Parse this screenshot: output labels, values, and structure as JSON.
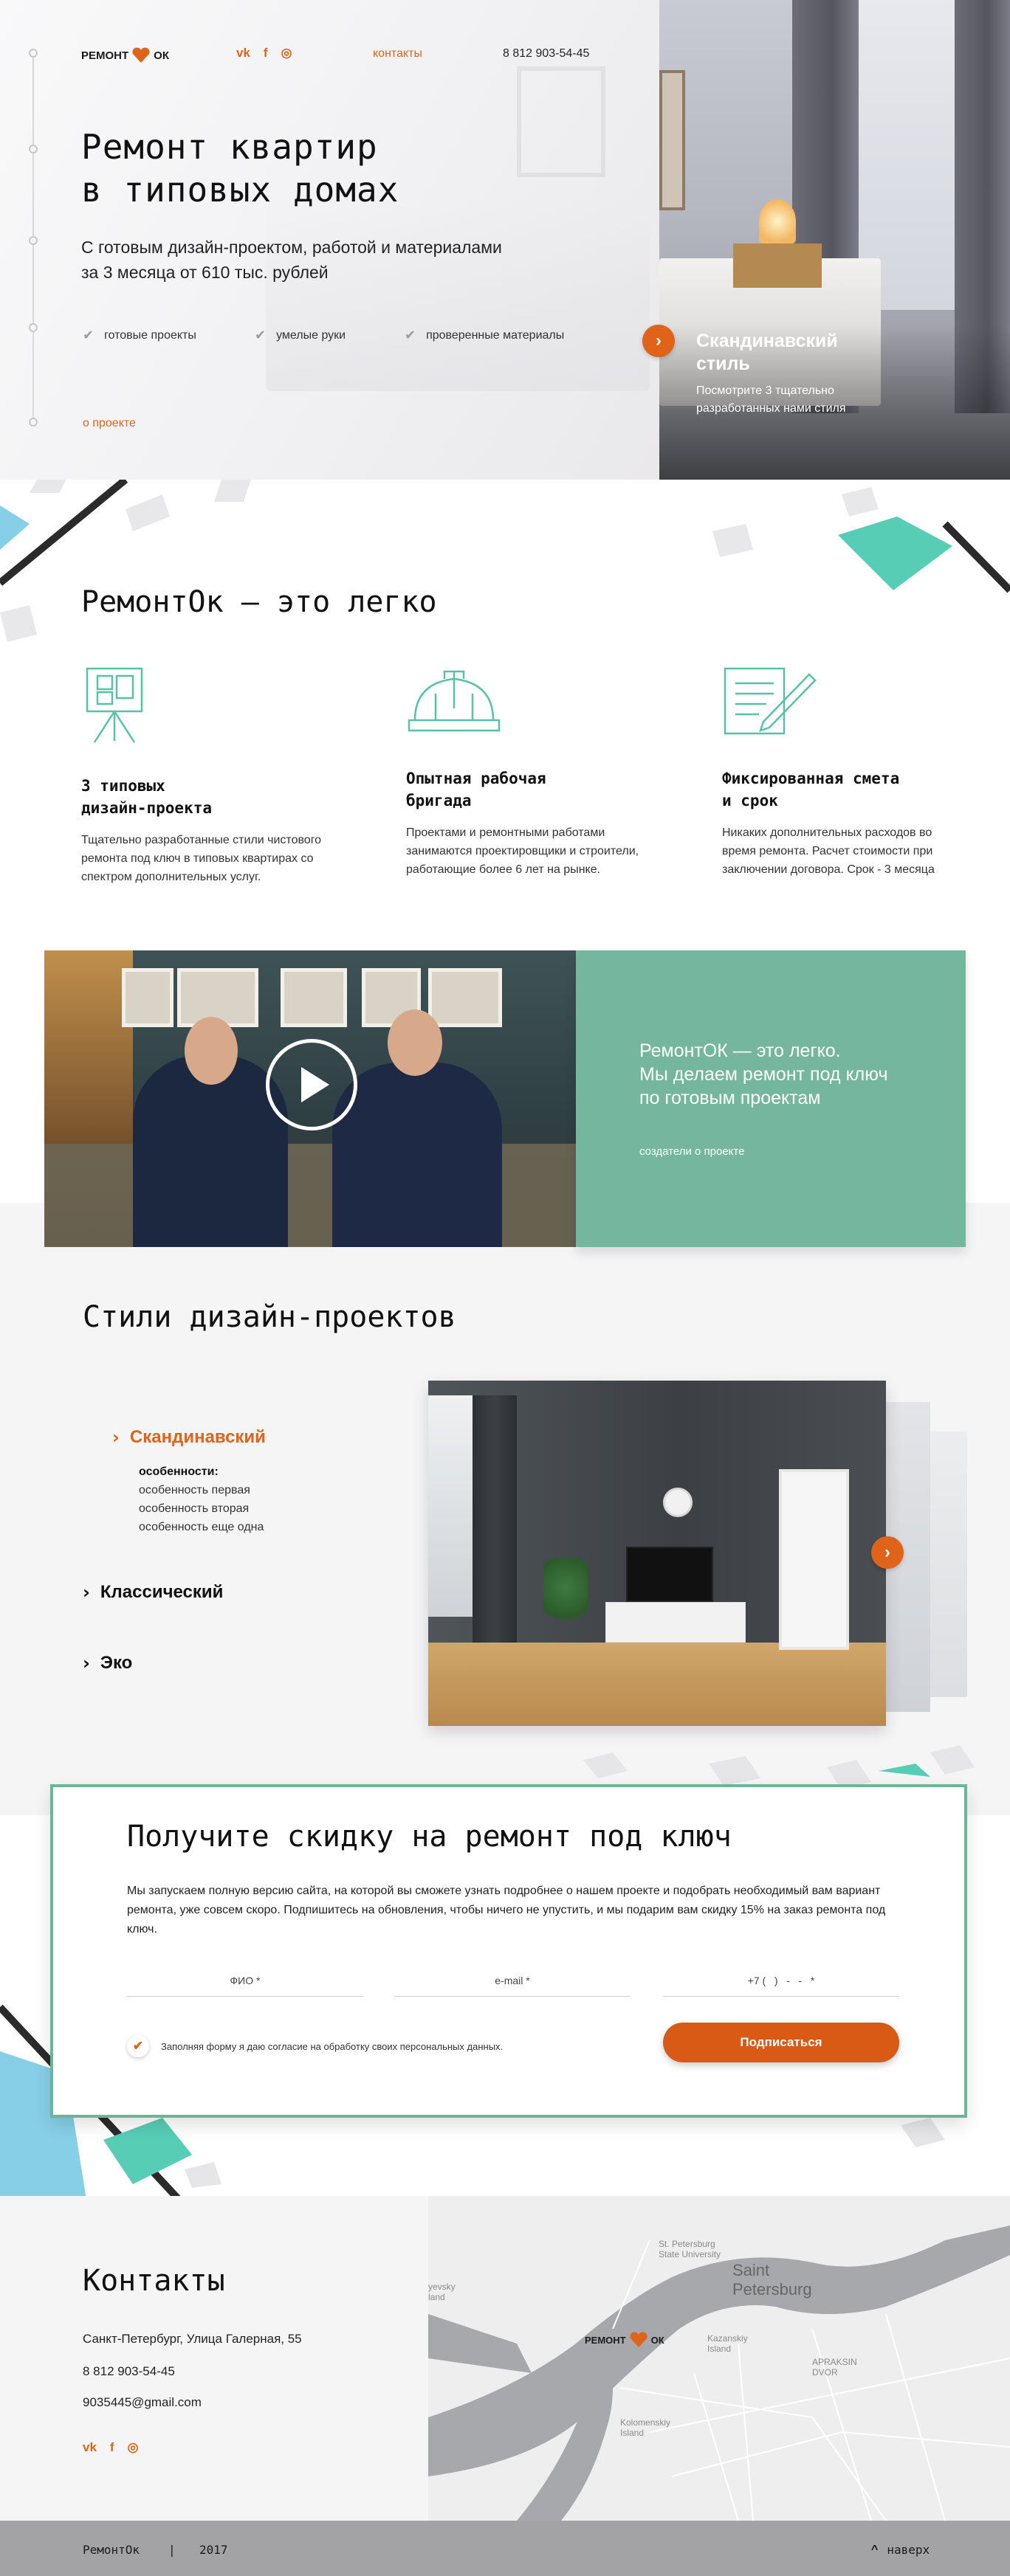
{
  "brand": {
    "logo_left": "РЕМОНТ",
    "logo_right": "ОК",
    "accent": "#e0631a",
    "green": "#75b79e"
  },
  "header": {
    "social": [
      {
        "icon": "vk-icon",
        "glyph": "vk"
      },
      {
        "icon": "facebook-icon",
        "glyph": "f"
      },
      {
        "icon": "instagram-icon",
        "glyph": "◎"
      }
    ],
    "contacts_link": "контакты",
    "phone": "8 812 903-54-45"
  },
  "hero": {
    "title_line1": "Ремонт квартир",
    "title_line2": "в типовых домах",
    "subtitle_line1": "С готовым дизайн-проектом, работой и материалами",
    "subtitle_line2": "за 3 месяца от 610 тыс. рублей",
    "features": [
      "готовые проекты",
      "умелые руки",
      "проверенные материалы"
    ],
    "about_link": "о проекте",
    "style_card_title_line1": "Скандинавский",
    "style_card_title_line2": "стиль",
    "style_card_desc_line1": "Посмотрите 3 тщательно",
    "style_card_desc_line2": "разработанных нами стиля"
  },
  "easy": {
    "title": "РемонтОк — это легко",
    "items": [
      {
        "icon": "easel-icon",
        "title_line1": "3 типовых",
        "title_line2": "дизайн-проекта",
        "desc_line1": "Тщательно разработанные стили чистового",
        "desc_line2": "ремонта под ключ в типовых квартирах со",
        "desc_line3": "спектром дополнительных услуг."
      },
      {
        "icon": "hard-hat-icon",
        "title_line1": "Опытная рабочая",
        "title_line2": "бригада",
        "desc_line1": "Проектами и ремонтными работами",
        "desc_line2": "занимаются проектировщики и строители,",
        "desc_line3": "работающие более 6 лет на рынке."
      },
      {
        "icon": "document-pen-icon",
        "title_line1": "Фиксированная смета",
        "title_line2": "и срок",
        "desc_line1": "Никаких дополнительных расходов во",
        "desc_line2": "время ремонта. Расчет стоимости при",
        "desc_line3": "заключении договора. Срок - 3 месяца"
      }
    ]
  },
  "video": {
    "line1": "РемонтОК — это легко.",
    "line2": "Мы делаем ремонт под ключ",
    "line3": "по готовым проектам",
    "link": "создатели о проекте"
  },
  "styles": {
    "title": "Стили дизайн-проектов",
    "items": [
      "Скандинавский",
      "Классический",
      "Эко"
    ],
    "features_header": "особенности:",
    "features": [
      "особенность первая",
      "особенность вторая",
      "особенность еще одна"
    ]
  },
  "discount": {
    "title": "Получите скидку на ремонт под ключ",
    "text": "Мы запускаем полную версию сайта, на которой вы сможете узнать подробнее о нашем проекте и подобрать необходимый вам вариант ремонта, уже совсем скоро. Подпишитесь на обновления, чтобы ничего не упустить, и мы подарим вам скидку 15% на заказ ремонта под ключ.",
    "name_placeholder": "ФИО *",
    "email_placeholder": "e-mail *",
    "phone_placeholder": "+7 (   )   -   -   *",
    "consent": "Заполняя форму я даю согласие на обработку своих персональных данных.",
    "button": "Подписаться"
  },
  "contacts": {
    "title": "Контакты",
    "address": "Санкт-Петербург, Улица Галерная, 55",
    "phone": "8 812 903-54-45",
    "email": "9035445@gmail.com",
    "map": {
      "city_line1": "Saint",
      "city_line2": "Petersburg",
      "univ_line1": "St. Petersburg",
      "univ_line2": "State University",
      "kazansky_line1": "Kazanskiy",
      "kazansky_line2": "Island",
      "kolomensky_line1": "Kolomenskiy",
      "kolomensky_line2": "Island",
      "apraksin_line1": "APRAKSIN",
      "apraksin_line2": "DVOR",
      "left_label_line1": "yevsky",
      "left_label_line2": "land"
    }
  },
  "footer": {
    "brand": "РемонтОк",
    "divider": "|",
    "year": "2017",
    "up": "наверх"
  }
}
